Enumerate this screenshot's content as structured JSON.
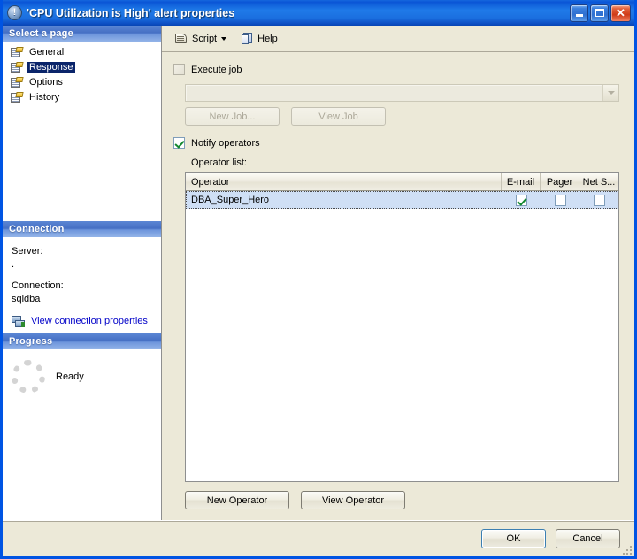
{
  "window": {
    "title": "'CPU Utilization is High' alert properties",
    "title_icon": "alert-circle-icon",
    "minimize_label": "_",
    "maximize_label": "□",
    "close_label": "✕",
    "accent_color": "#0054e3",
    "face_color": "#ece9d8"
  },
  "sidebar": {
    "pages_header": "Select a page",
    "items": [
      {
        "label": "General",
        "selected": false
      },
      {
        "label": "Response",
        "selected": true
      },
      {
        "label": "Options",
        "selected": false
      },
      {
        "label": "History",
        "selected": false
      }
    ],
    "connection": {
      "header": "Connection",
      "server_label": "Server:",
      "server_value": ".",
      "connection_label": "Connection:",
      "connection_value": "sqldba",
      "link_text": "View connection properties",
      "link_color": "#0000c8"
    },
    "progress": {
      "header": "Progress",
      "status": "Ready"
    }
  },
  "toolbar": {
    "script_label": "Script",
    "help_label": "Help"
  },
  "main": {
    "execute_job": {
      "label": "Execute job",
      "checked": false,
      "combo_value": "",
      "new_job_label": "New Job...",
      "view_job_label": "View Job"
    },
    "notify_operators": {
      "label": "Notify operators",
      "checked": true
    },
    "operator_list": {
      "label": "Operator list:",
      "columns": [
        "Operator",
        "E-mail",
        "Pager",
        "Net S..."
      ],
      "rows": [
        {
          "operator": "DBA_Super_Hero",
          "email": true,
          "pager": false,
          "net_send": false,
          "selected": true
        }
      ]
    },
    "new_operator_label": "New Operator",
    "view_operator_label": "View Operator"
  },
  "footer": {
    "ok_label": "OK",
    "cancel_label": "Cancel"
  }
}
